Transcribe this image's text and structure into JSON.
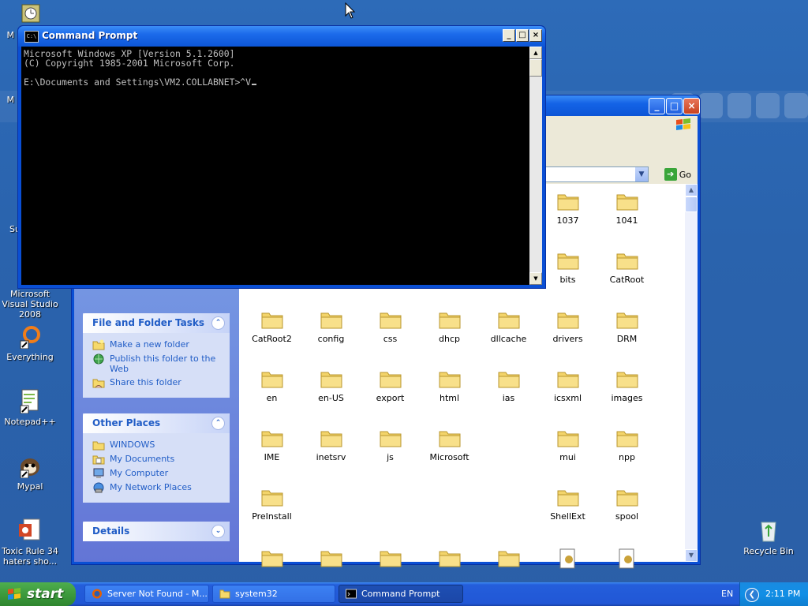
{
  "colors": {
    "accent": "#0a4fd4",
    "taskpane_link": "#215dc6",
    "start_green": "#3c9a3c"
  },
  "desktop": {
    "icons": [
      {
        "label": "Microsoft Visual Studio 2008",
        "icon": "visual-studio-icon"
      },
      {
        "label": "Everything",
        "icon": "everything-search-icon"
      },
      {
        "label": "Notepad++",
        "icon": "notepad-plus-plus-icon"
      },
      {
        "label": "Mypal",
        "icon": "mypal-browser-icon"
      },
      {
        "label": "Toxic Rule 34 haters sho...",
        "icon": "powerpoint-file-icon"
      },
      {
        "label": "Recycle Bin",
        "icon": "recycle-bin-icon"
      }
    ],
    "partial_labels": [
      "M",
      "M",
      "Su"
    ]
  },
  "cmd": {
    "title": "Command Prompt",
    "icon_text": "C:\\",
    "lines": "Microsoft Windows XP [Version 5.1.2600]\n(C) Copyright 1985-2001 Microsoft Corp.\n\nE:\\Documents and Settings\\VM2.COLLABNET>^V"
  },
  "explorer": {
    "title": "system32",
    "go_label": "Go",
    "panels": [
      {
        "title": "File and Folder Tasks",
        "tasks": [
          {
            "label": "Make a new folder",
            "icon": "new-folder-icon"
          },
          {
            "label": "Publish this folder to the Web",
            "icon": "publish-web-icon"
          },
          {
            "label": "Share this folder",
            "icon": "share-folder-icon"
          }
        ]
      },
      {
        "title": "Other Places",
        "tasks": [
          {
            "label": "WINDOWS",
            "icon": "folder-icon"
          },
          {
            "label": "My Documents",
            "icon": "my-documents-icon"
          },
          {
            "label": "My Computer",
            "icon": "my-computer-icon"
          },
          {
            "label": "My Network Places",
            "icon": "network-places-icon"
          }
        ]
      },
      {
        "title": "Details",
        "tasks": []
      }
    ],
    "folders": [
      [
        "",
        "",
        "",
        "",
        "",
        "1037",
        "1041"
      ],
      [
        "",
        "",
        "",
        "",
        "",
        "bits",
        "CatRoot"
      ],
      [
        "CatRoot2",
        "config",
        "css",
        "dhcp",
        "dllcache",
        "drivers",
        "DRM"
      ],
      [
        "en",
        "en-US",
        "export",
        "html",
        "ias",
        "icsxml",
        "images"
      ],
      [
        "IME",
        "inetsrv",
        "js",
        "Microsoft",
        "",
        "mui",
        "npp"
      ],
      [
        "PreInstall",
        "",
        "",
        "",
        "",
        "ShellExt",
        "spool"
      ]
    ]
  },
  "taskbar": {
    "start_label": "start",
    "buttons": [
      {
        "label": "Server Not Found - M...",
        "icon": "firefox-icon",
        "active": false
      },
      {
        "label": "system32",
        "icon": "folder-icon",
        "active": false
      },
      {
        "label": "Command Prompt",
        "icon": "cmd-icon",
        "active": true
      }
    ],
    "language": "EN",
    "clock": "2:11 PM"
  }
}
